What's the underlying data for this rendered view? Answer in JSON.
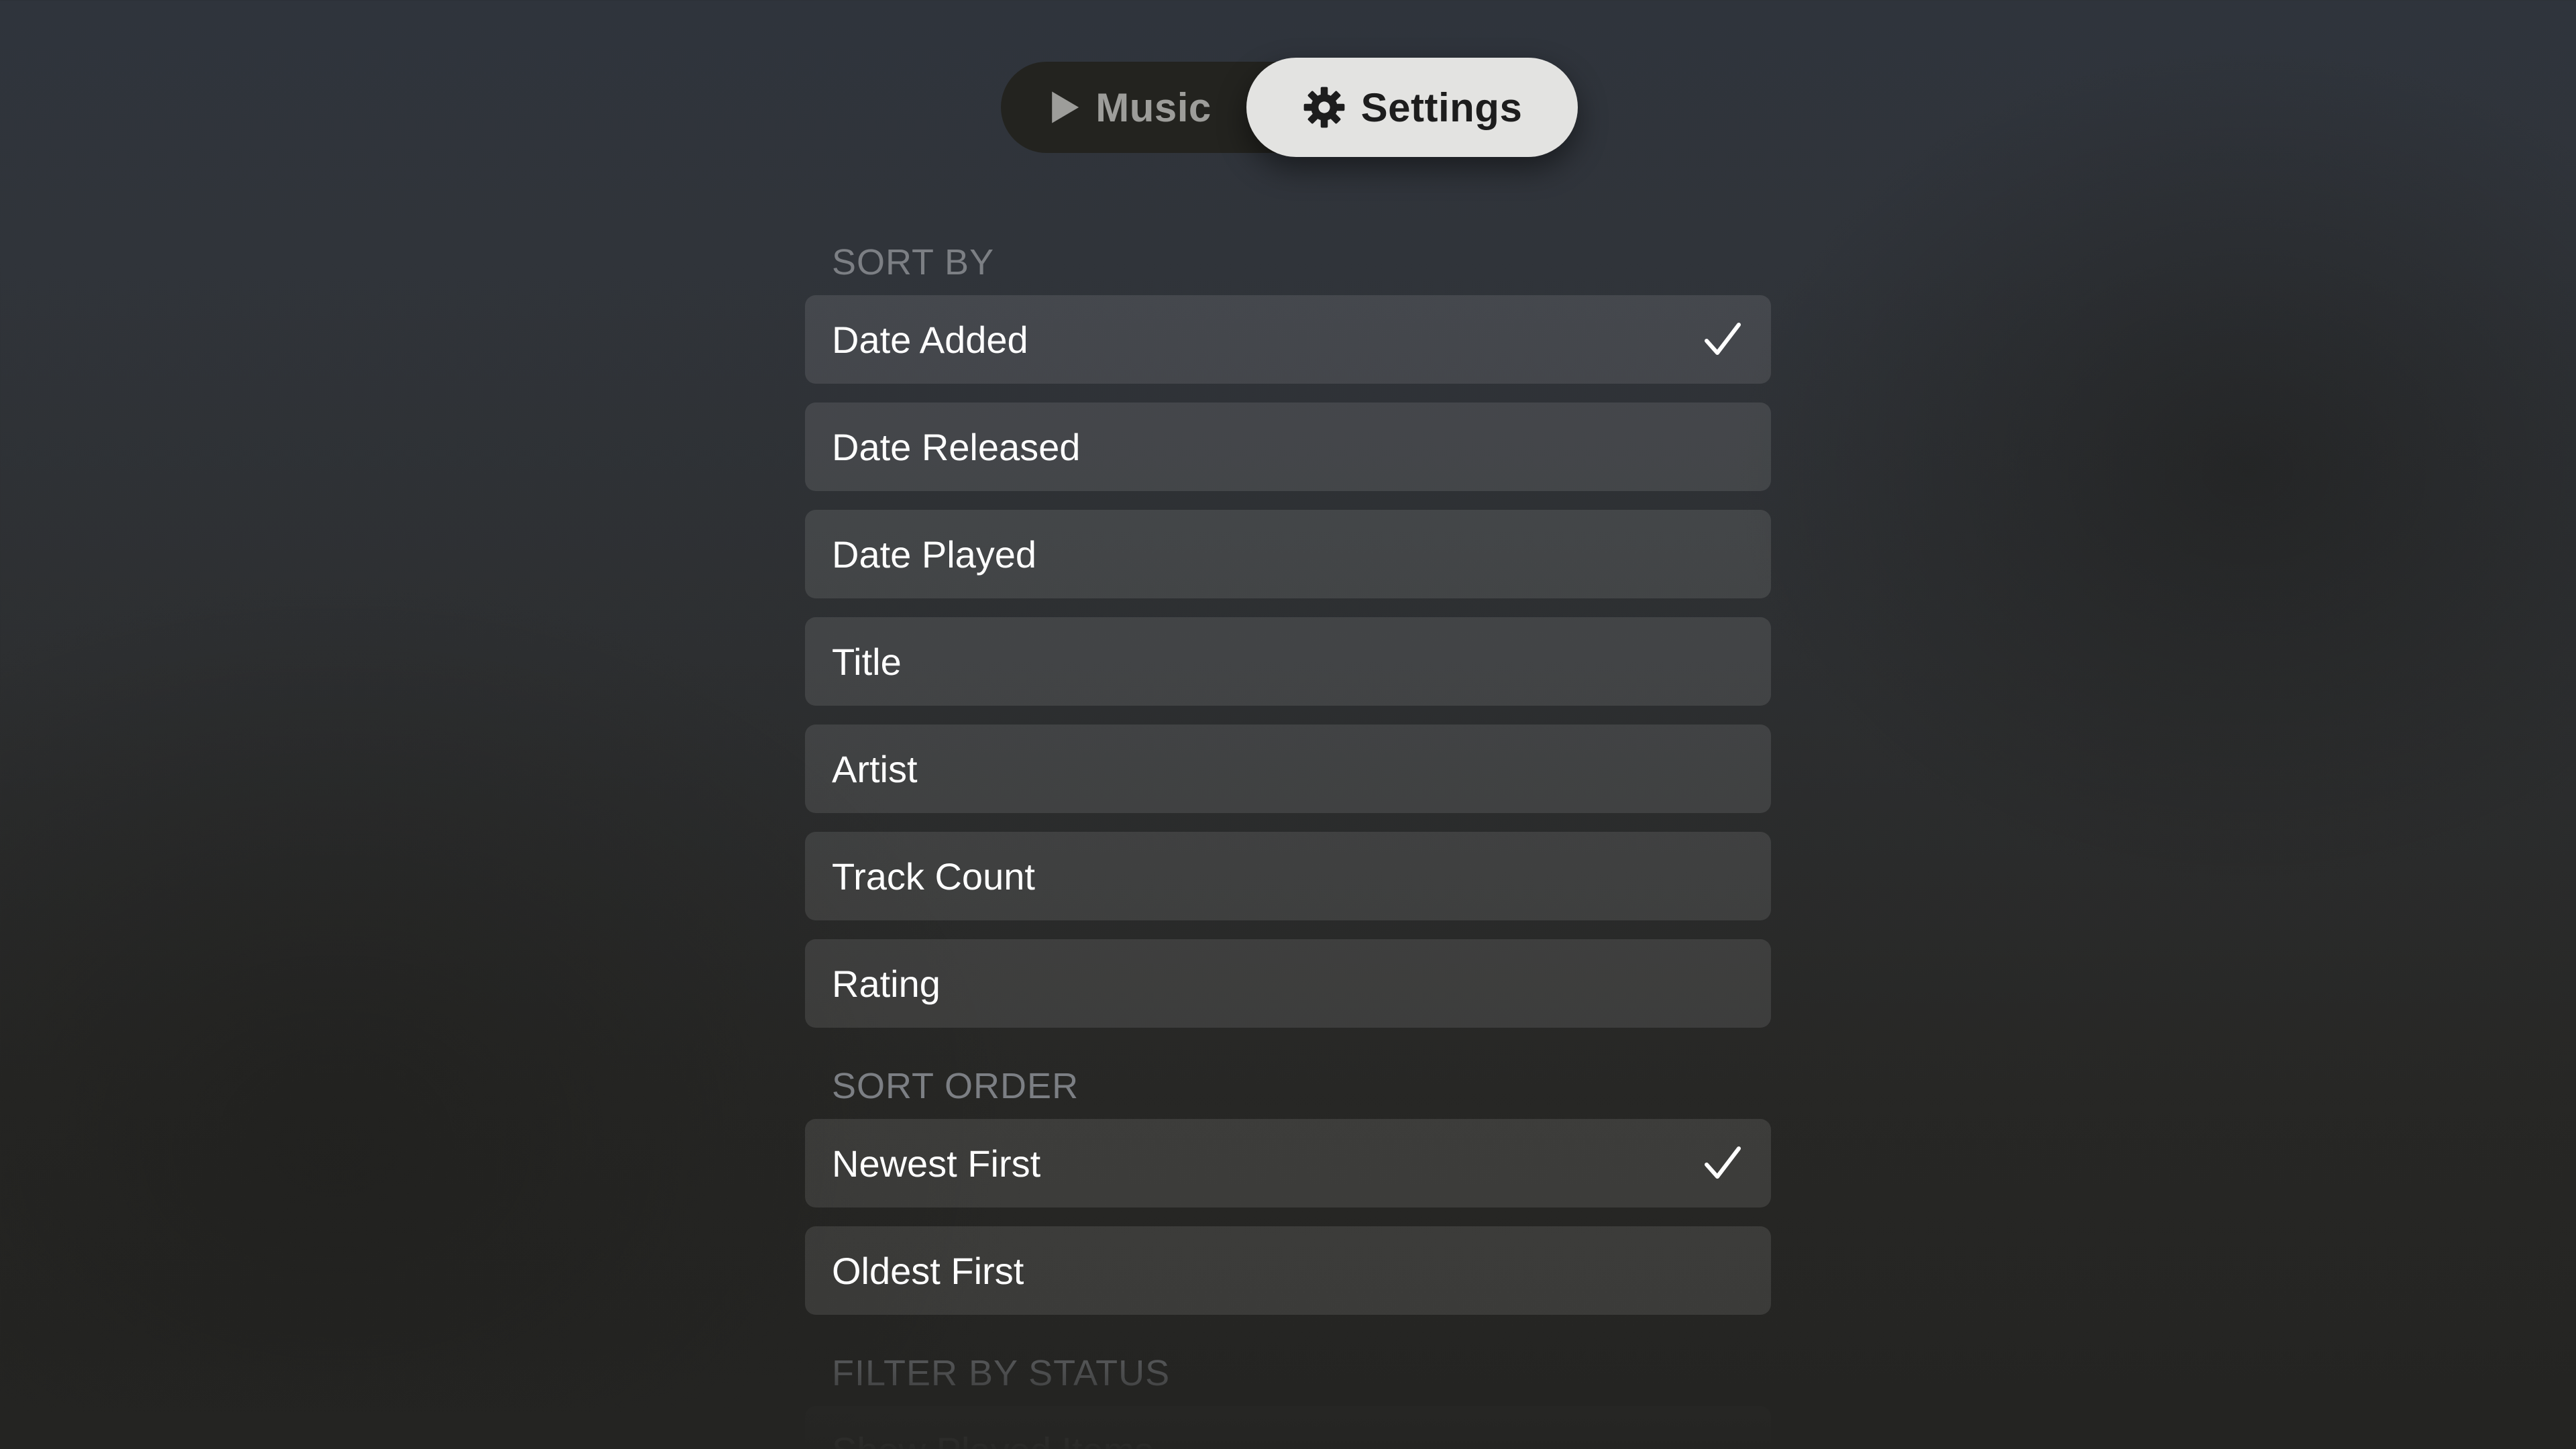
{
  "tabs": {
    "music": {
      "label": "Music",
      "icon": "play-icon"
    },
    "settings": {
      "label": "Settings",
      "icon": "gear-icon",
      "selected": true
    }
  },
  "sections": {
    "sort_by": {
      "header": "SORT BY",
      "items": [
        {
          "label": "Date Added",
          "checked": true
        },
        {
          "label": "Date Released",
          "checked": false
        },
        {
          "label": "Date Played",
          "checked": false
        },
        {
          "label": "Title",
          "checked": false
        },
        {
          "label": "Artist",
          "checked": false
        },
        {
          "label": "Track Count",
          "checked": false
        },
        {
          "label": "Rating",
          "checked": false
        }
      ]
    },
    "sort_order": {
      "header": "SORT ORDER",
      "items": [
        {
          "label": "Newest First",
          "checked": true
        },
        {
          "label": "Oldest First",
          "checked": false
        }
      ]
    },
    "filter_by_status": {
      "header": "FILTER BY STATUS",
      "items": [
        {
          "label": "Show Played Items",
          "checked": false
        }
      ]
    }
  },
  "colors": {
    "accent_selected_tab": "#e3e3e1",
    "row_background": "rgba(255,255,255,0.10)",
    "section_header": "#7c7f84"
  }
}
